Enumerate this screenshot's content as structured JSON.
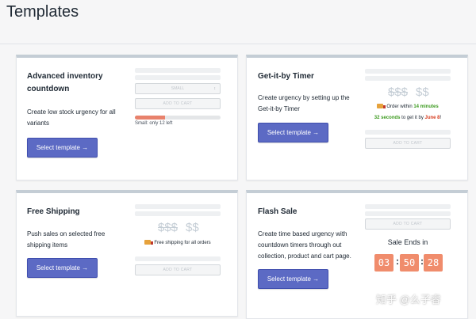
{
  "page": {
    "title": "Templates"
  },
  "cards": {
    "inventory": {
      "title": "Advanced inventory countdown",
      "description": "Create low stock urgency for all variants",
      "button": "Select template →",
      "preview": {
        "select_value": "SMALL",
        "add_to_cart": "ADD TO CART",
        "stock_note": "Small: only 12 left",
        "stock_level": 0.35
      }
    },
    "timer": {
      "title": "Get-it-by Timer",
      "description": "Create urgency by setting up the Get-it-by Timer",
      "button": "Select template →",
      "preview": {
        "price_old": "$$$",
        "price_new": "$$",
        "order_prefix": "Order within ",
        "order_time": "14 minutes",
        "seconds": "32 seconds",
        "get_it_by": " to get it by ",
        "date": "June 8",
        "date_suffix": "!",
        "add_to_cart": "ADD TO CART"
      }
    },
    "shipping": {
      "title": "Free Shipping",
      "description": "Push sales on selected free shipping items",
      "button": "Select template →",
      "preview": {
        "price_old": "$$$",
        "price_new": "$$",
        "note": "Free shipping for all orders",
        "add_to_cart": "ADD TO CART"
      }
    },
    "flash": {
      "title": "Flash Sale",
      "description": "Create time based urgency with countdown timers through out collection, product and cart page.",
      "button": "Select template →",
      "preview": {
        "add_to_cart": "ADD TO CART",
        "sale_ends": "Sale Ends in",
        "hours": "03",
        "minutes": "50",
        "seconds": "28"
      }
    }
  },
  "watermark": "知乎 @么子睿"
}
